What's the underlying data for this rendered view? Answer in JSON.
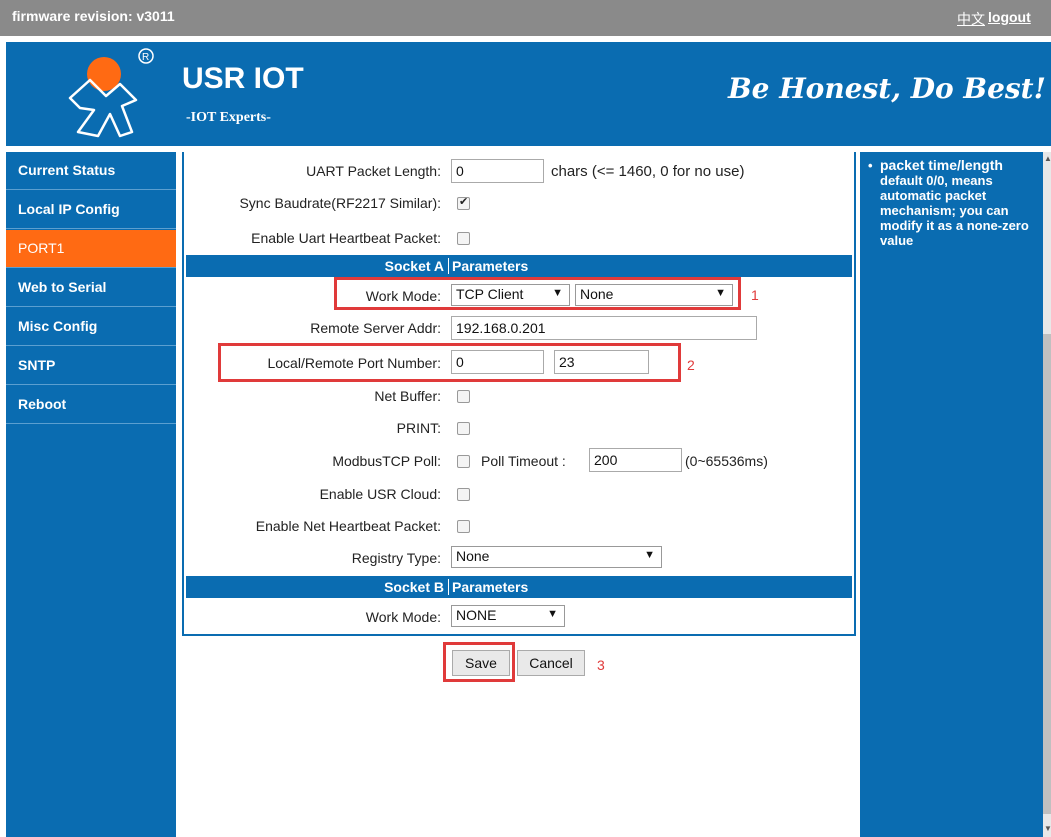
{
  "topbar": {
    "firmware": "firmware revision: v3011",
    "lang": "中文",
    "logout": "logout"
  },
  "header": {
    "brand": "USR IOT",
    "tagline": "-IOT Experts-",
    "motto": "Be Honest, Do Best!",
    "logo_icon": "runner-logo-icon"
  },
  "sidebar": {
    "items": [
      {
        "label": "Current Status"
      },
      {
        "label": "Local IP Config"
      },
      {
        "label": "PORT1",
        "active": true
      },
      {
        "label": "Web to Serial"
      },
      {
        "label": "Misc Config"
      },
      {
        "label": "SNTP"
      },
      {
        "label": "Reboot"
      }
    ]
  },
  "form": {
    "uart_packet_length": {
      "label": "UART Packet Length:",
      "value": "0",
      "hint": "chars (<= 1460, 0 for no use)"
    },
    "sync_baudrate": {
      "label": "Sync Baudrate(RF2217 Similar):",
      "checked": true
    },
    "uart_heartbeat": {
      "label": "Enable Uart Heartbeat Packet:",
      "checked": false
    },
    "socket_a": {
      "left": "Socket A",
      "right": "Parameters"
    },
    "work_mode": {
      "label": "Work Mode:",
      "value": "TCP Client",
      "sub_value": "None"
    },
    "remote_server": {
      "label": "Remote Server Addr:",
      "value": "192.168.0.201"
    },
    "port_number": {
      "label": "Local/Remote Port Number:",
      "local": "0",
      "remote": "23"
    },
    "net_buffer": {
      "label": "Net Buffer:",
      "checked": false
    },
    "print": {
      "label": "PRINT:",
      "checked": false
    },
    "modbus_poll": {
      "label": "ModbusTCP Poll:",
      "checked": false,
      "timeout_label": "Poll Timeout :",
      "timeout_value": "200",
      "timeout_hint": "(0~65536ms)"
    },
    "usr_cloud": {
      "label": "Enable USR Cloud:",
      "checked": false
    },
    "net_heartbeat": {
      "label": "Enable Net Heartbeat Packet:",
      "checked": false
    },
    "registry_type": {
      "label": "Registry Type:",
      "value": "None"
    },
    "socket_b": {
      "left": "Socket B",
      "right": "Parameters"
    },
    "work_mode_b": {
      "label": "Work Mode:",
      "value": "NONE"
    }
  },
  "buttons": {
    "save": "Save",
    "cancel": "Cancel"
  },
  "annotations": {
    "n1": "1",
    "n2": "2",
    "n3": "3",
    "color": "#e03a3a"
  },
  "help": {
    "title": "packet time/length",
    "body": "default 0/0, means automatic packet mechanism; you can modify it as a none-zero value"
  },
  "colors": {
    "brand_blue": "#0a6cb1",
    "active_orange": "#ff6a13",
    "topbar_gray": "#8a8a8a"
  }
}
